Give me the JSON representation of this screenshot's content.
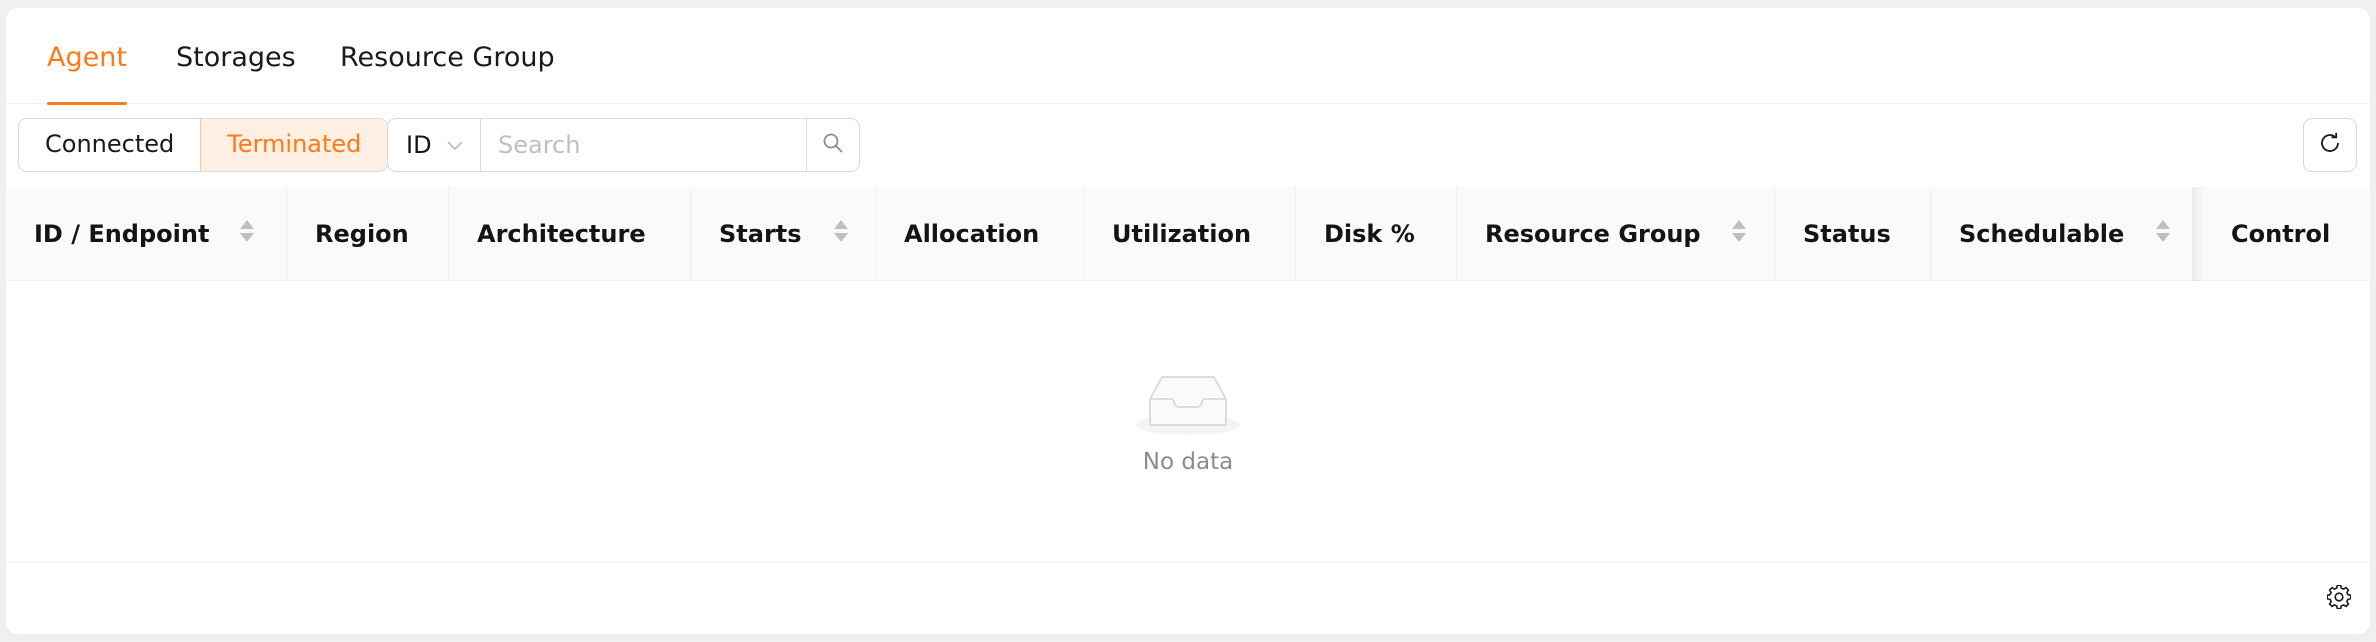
{
  "tabs": [
    {
      "label": "Agent",
      "active": true
    },
    {
      "label": "Storages",
      "active": false
    },
    {
      "label": "Resource Group",
      "active": false
    }
  ],
  "toolbar": {
    "segments": [
      "Connected",
      "Terminated"
    ],
    "selected_segment": "Terminated",
    "field_select_value": "ID",
    "search_placeholder": "Search",
    "search_value": ""
  },
  "table": {
    "columns": [
      {
        "label": "ID / Endpoint",
        "sortable": true
      },
      {
        "label": "Region",
        "sortable": false
      },
      {
        "label": "Architecture",
        "sortable": false
      },
      {
        "label": "Starts",
        "sortable": true
      },
      {
        "label": "Allocation",
        "sortable": false
      },
      {
        "label": "Utilization",
        "sortable": false
      },
      {
        "label": "Disk %",
        "sortable": false
      },
      {
        "label": "Resource Group",
        "sortable": true
      },
      {
        "label": "Status",
        "sortable": false
      },
      {
        "label": "Schedulable",
        "sortable": true
      },
      {
        "label": "Control",
        "sortable": false
      }
    ],
    "rows": [],
    "empty_text": "No data"
  },
  "icons": {
    "field_select": "chevron-down-icon",
    "search": "search-icon",
    "refresh": "refresh-icon",
    "empty": "empty-inbox-icon",
    "settings": "gear-icon"
  },
  "colors": {
    "accent": "#ff7a1a",
    "accent_bg": "#fff0e3",
    "header_bg": "#fafafa",
    "muted_text": "#8c8c8c"
  }
}
